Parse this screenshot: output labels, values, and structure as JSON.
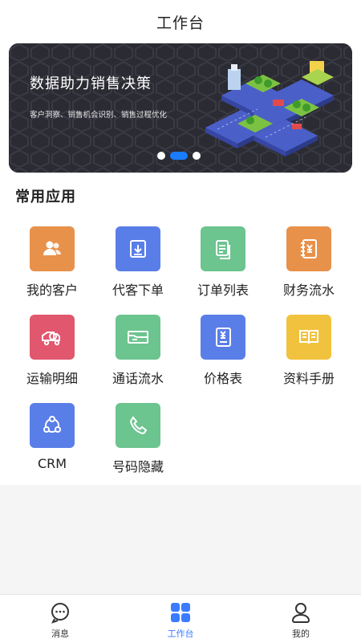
{
  "header": {
    "title": "工作台"
  },
  "banner": {
    "headline": "数据助力销售决策",
    "subtitle": "客户洞察、销售机会识别、销售过程优化",
    "slide_count": 3,
    "active_slide": 2
  },
  "section": {
    "title": "常用应用"
  },
  "apps": [
    {
      "label": "我的客户",
      "icon": "customers-icon",
      "color": "#e8914a"
    },
    {
      "label": "代客下单",
      "icon": "download-order-icon",
      "color": "#5a7ee8"
    },
    {
      "label": "订单列表",
      "icon": "order-list-icon",
      "color": "#6cc48f"
    },
    {
      "label": "财务流水",
      "icon": "finance-notebook-icon",
      "color": "#e8914a"
    },
    {
      "label": "运输明细",
      "icon": "truck-icon",
      "color": "#e0576e"
    },
    {
      "label": "通话流水",
      "icon": "call-record-icon",
      "color": "#6cc48f"
    },
    {
      "label": "价格表",
      "icon": "price-book-icon",
      "color": "#5a7ee8"
    },
    {
      "label": "资料手册",
      "icon": "manual-book-icon",
      "color": "#f1c23d"
    },
    {
      "label": "CRM",
      "icon": "crm-network-icon",
      "color": "#5a7ee8"
    },
    {
      "label": "号码隐藏",
      "icon": "phone-icon",
      "color": "#6cc48f"
    }
  ],
  "tabbar": {
    "items": [
      {
        "label": "消息",
        "icon": "message-icon"
      },
      {
        "label": "工作台",
        "icon": "grid-icon"
      },
      {
        "label": "我的",
        "icon": "user-icon"
      }
    ],
    "active": 1,
    "active_color": "#3a7bff"
  }
}
